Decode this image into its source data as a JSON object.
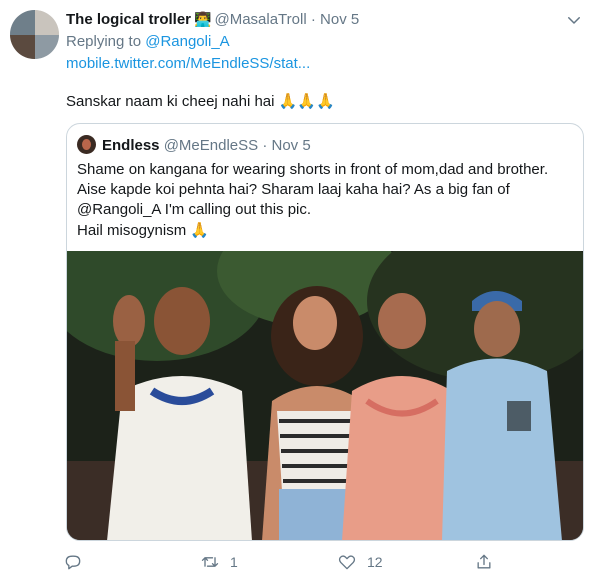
{
  "tweet": {
    "author_name": "The logical troller",
    "author_emoji": "👨‍💻",
    "author_handle": "@MasalaTroll",
    "separator": "·",
    "date": "Nov 5",
    "reply_prefix": "Replying to",
    "reply_to": "@Rangoli_A",
    "link": "mobile.twitter.com/MeEndleSS/stat...",
    "text": "Sanskar naam ki cheej nahi hai",
    "text_emoji": "🙏🙏🙏"
  },
  "quoted": {
    "author_name": "Endless",
    "author_handle": "@MeEndleSS",
    "separator": "·",
    "date": "Nov 5",
    "lines": [
      "Shame on kangana for wearing shorts in front of mom,dad and brother.",
      "Aise kapde koi pehnta hai? Sharam laaj kaha hai? As a big fan of",
      "@Rangoli_A I'm calling out this pic.",
      "Hail misogynism"
    ],
    "line_emoji": "🙏"
  },
  "actions": {
    "reply_count": "",
    "retweet_count": "1",
    "like_count": "12"
  },
  "icons": [
    "avatar-image",
    "chevron-down-icon",
    "reply-icon",
    "retweet-icon",
    "heart-icon",
    "share-icon"
  ],
  "colors": {
    "link": "#1b95e0",
    "muted": "#657786",
    "border": "#ccd6dd"
  }
}
